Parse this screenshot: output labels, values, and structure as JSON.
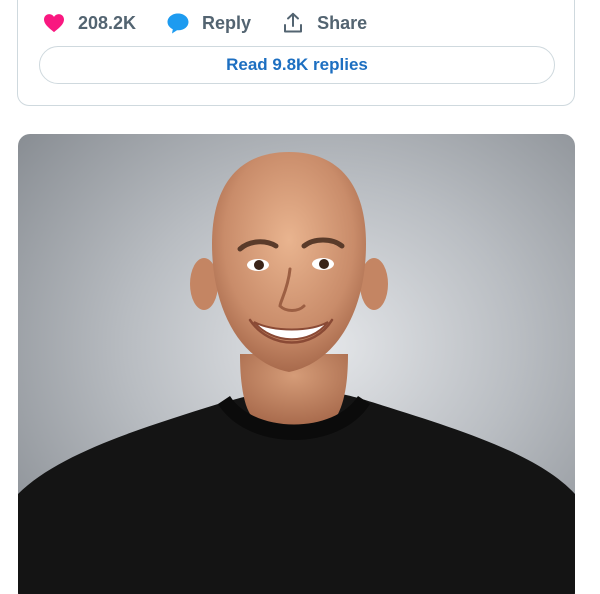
{
  "tweet": {
    "like_count": "208.2K",
    "reply_label": "Reply",
    "share_label": "Share",
    "read_replies_label": "Read 9.8K replies"
  },
  "icons": {
    "like": "heart-icon",
    "reply": "speech-bubble-icon",
    "share": "share-upload-icon"
  },
  "colors": {
    "like_pink": "#f91880",
    "reply_blue": "#1d9bf0",
    "link_blue": "#1d6fc1",
    "muted_text": "#536471",
    "border": "#cfd9de"
  },
  "photo": {
    "subject": "portrait-smiling-man-black-tshirt"
  }
}
